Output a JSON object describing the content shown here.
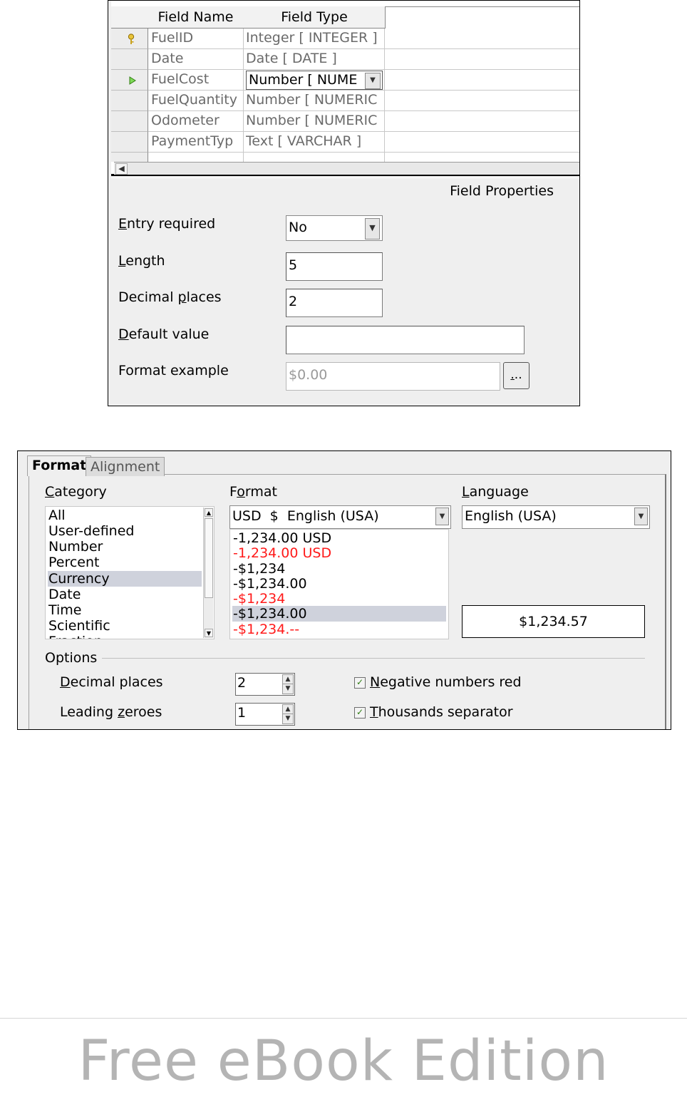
{
  "table_design": {
    "headers": {
      "field_name": "Field Name",
      "field_type": "Field Type"
    },
    "rows": [
      {
        "name": "FuelID",
        "type": "Integer [ INTEGER ]",
        "marker": "primary-key"
      },
      {
        "name": "Date",
        "type": "Date [ DATE ]",
        "marker": ""
      },
      {
        "name": "FuelCost",
        "type": "Number [ NUME",
        "marker": "current-row"
      },
      {
        "name": "FuelQuantity",
        "type": "Number [ NUMERIC",
        "marker": ""
      },
      {
        "name": "Odometer",
        "type": "Number [ NUMERIC",
        "marker": ""
      },
      {
        "name": "PaymentTyp",
        "type": "Text [ VARCHAR ]",
        "marker": ""
      }
    ],
    "field_properties": {
      "title": "Field Properties",
      "entry_required": {
        "label_u": "E",
        "label_rest": "ntry required",
        "value": "No"
      },
      "length": {
        "label_u": "L",
        "label_rest": "ength",
        "value": "5"
      },
      "decimal_places": {
        "label_pre": "Decimal ",
        "label_u": "p",
        "label_rest": "laces",
        "value": "2"
      },
      "default_value": {
        "label_u": "D",
        "label_rest": "efault value",
        "value": ""
      },
      "format_example": {
        "label": "Format example",
        "value": "$0.00",
        "button_u": ".",
        "button_rest": ".."
      }
    }
  },
  "format_dialog": {
    "tabs": [
      "Format",
      "Alignment"
    ],
    "category": {
      "label_u": "C",
      "label_rest": "ategory",
      "items": [
        "All",
        "User-defined",
        "Number",
        "Percent",
        "Currency",
        "Date",
        "Time",
        "Scientific",
        "Fraction"
      ],
      "selected": "Currency"
    },
    "format": {
      "label_pre": "F",
      "label_u": "o",
      "label_rest": "rmat",
      "dropdown_value": "USD  $  English (USA)",
      "list": [
        {
          "text": "-1,234.00 USD",
          "color": "#000000"
        },
        {
          "text": "-1,234.00 USD",
          "color": "#ff1a1a"
        },
        {
          "text": "-$1,234",
          "color": "#000000"
        },
        {
          "text": "-$1,234.00",
          "color": "#000000"
        },
        {
          "text": "-$1,234",
          "color": "#ff1a1a"
        },
        {
          "text": "-$1,234.00",
          "color": "#000000",
          "selected": true
        },
        {
          "text": "-$1,234.--",
          "color": "#ff1a1a"
        }
      ]
    },
    "language": {
      "label_u": "L",
      "label_rest": "anguage",
      "value": "English (USA)"
    },
    "preview": "$1,234.57",
    "options": {
      "title": "Options",
      "decimal_places": {
        "label_u": "D",
        "label_rest": "ecimal places",
        "value": "2"
      },
      "leading_zeroes": {
        "label_pre": "Leading ",
        "label_u": "z",
        "label_rest": "eroes",
        "value": "1"
      },
      "negative_red": {
        "label_u": "N",
        "label_rest": "egative numbers red",
        "checked": true
      },
      "thousands_sep": {
        "label_u": "T",
        "label_rest": "housands separator",
        "checked": true
      }
    }
  },
  "watermark": "Free eBook Edition",
  "colors": {
    "selection": "#cfd2dc",
    "negative_red": "#ff1a1a",
    "check_green": "#2e7d12"
  }
}
